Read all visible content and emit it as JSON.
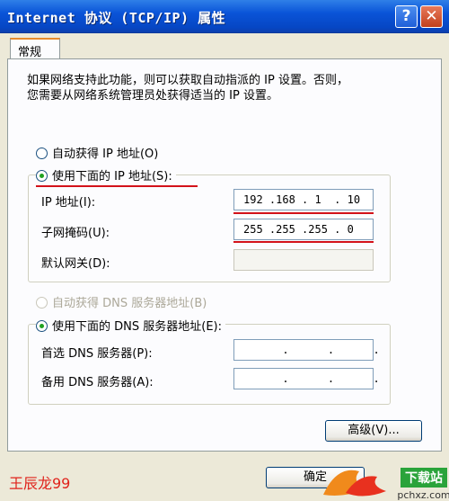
{
  "window": {
    "title": "Internet 协议 (TCP/IP) 属性",
    "help_button": "?",
    "close_button": "✕"
  },
  "tabs": [
    {
      "label": "常规"
    }
  ],
  "description": {
    "line1": "如果网络支持此功能，则可以获取自动指派的 IP 设置。否则，",
    "line2": "您需要从网络系统管理员处获得适当的 IP 设置。"
  },
  "ip_section": {
    "auto_label": "自动获得 IP 地址(O)",
    "manual_label": "使用下面的 IP 地址(S):",
    "ip_label": "IP 地址(I):",
    "ip_value": "192 .168 . 1  . 10",
    "mask_label": "子网掩码(U):",
    "mask_value": "255 .255 .255 . 0",
    "gateway_label": "默认网关(D):",
    "gateway_value": ""
  },
  "dns_section": {
    "auto_label": "自动获得 DNS 服务器地址(B)",
    "manual_label": "使用下面的 DNS 服务器地址(E):",
    "preferred_label": "首选 DNS 服务器(P):",
    "preferred_value": "      .      .      .",
    "alternate_label": "备用 DNS 服务器(A):",
    "alternate_value": "      .      .      ."
  },
  "buttons": {
    "advanced": "高级(V)...",
    "ok": "确定"
  },
  "watermark": {
    "author": "王辰龙99",
    "logo_text": "下载站",
    "logo_url": "pchxz.com"
  },
  "colors": {
    "titlebar": "#0a54d8",
    "accent_line": "#d3121a",
    "radio_dot": "#21a121"
  }
}
